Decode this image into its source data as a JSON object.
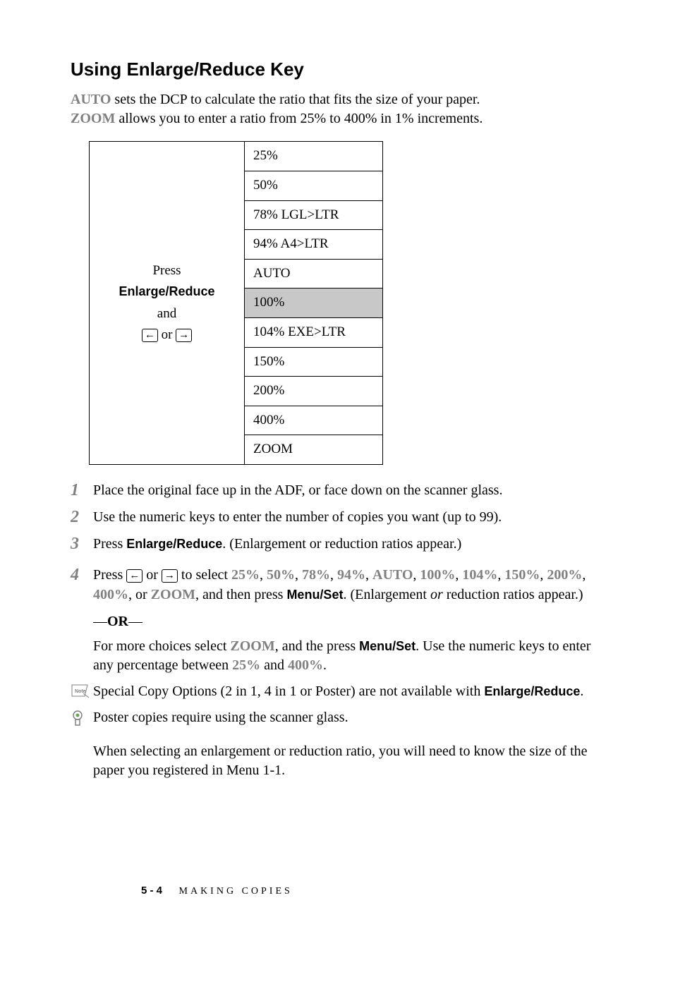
{
  "heading": "Using Enlarge/Reduce Key",
  "intro": {
    "auto": "AUTO",
    "auto_text": " sets the DCP to calculate the ratio that fits the size of your paper.",
    "zoom": "ZOOM",
    "zoom_text": " allows you to enter a ratio from 25% to 400% in 1% increments."
  },
  "table": {
    "left": {
      "press": "Press",
      "enlarge_reduce": "Enlarge/Reduce",
      "and": "and",
      "or": " or "
    },
    "rows": [
      "25%",
      "50%",
      "78% LGL>LTR",
      "94% A4>LTR",
      "AUTO",
      "100%",
      "104% EXE>LTR",
      "150%",
      "200%",
      "400%",
      "ZOOM"
    ]
  },
  "steps": {
    "s1": "Place the original face up in the ADF, or face down on the scanner glass.",
    "s2": "Use the numeric keys to enter the number of copies you want (up to 99).",
    "s3_a": "Press ",
    "s3_b": "Enlarge/Reduce",
    "s3_c": ". (Enlargement or reduction ratios appear.)",
    "s4": {
      "a": "Press ",
      "or": " or ",
      "b": " to select ",
      "v25": "25%",
      "v50": "50%",
      "v78": "78%",
      "v94": "94%",
      "auto": "AUTO",
      "v100": "100%",
      "v104": "104%",
      "v150": "150%",
      "v200": "200%",
      "v400": "400%",
      "orzoom": ", or ",
      "zoom": "ZOOM",
      "then": ", and then press ",
      "menuset": "Menu/Set",
      "end": ". (Enlargement ",
      "or_ital": "or",
      "end2": " reduction ratios appear.)"
    },
    "or_sep": "OR",
    "s4b": {
      "a": "For  more choices select ",
      "zoom": "ZOOM",
      "b": ", and the press ",
      "menuset": "Menu/Set",
      "c": ". Use the numeric keys to enter any percentage between ",
      "v25": "25%",
      "and": " and ",
      "v400": "400%",
      "d": "."
    }
  },
  "notes": {
    "n1a": "Special Copy Options (2 in 1, 4 in 1 or Poster) are not available with ",
    "n1b": "Enlarge/Reduce",
    "n1c": ".",
    "n2": "Poster copies require using the scanner glass.",
    "n3": "When selecting an enlargement or reduction ratio, you will need to know the size of the paper you registered in Menu 1-1."
  },
  "footer": {
    "page": "5 - 4",
    "title": "MAKING COPIES"
  }
}
